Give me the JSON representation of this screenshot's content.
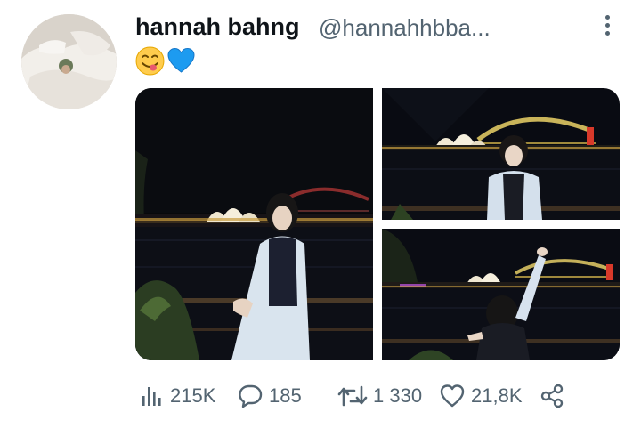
{
  "tweet": {
    "display_name": "hannah bahng",
    "handle": "@hannahhbba...",
    "emojis": [
      {
        "icon": "yum-face-emoji",
        "glyph": "😋"
      },
      {
        "icon": "blue-heart-emoji",
        "glyph": "💙"
      }
    ],
    "photos": [
      {
        "icon": "photo-opera-house-night-portrait"
      },
      {
        "icon": "photo-harbour-bridge-smiling"
      },
      {
        "icon": "photo-harbour-waving"
      }
    ]
  },
  "actions": {
    "views": {
      "icon": "bar-chart-icon",
      "value": "215K"
    },
    "replies": {
      "icon": "reply-bubble-icon",
      "value": "185"
    },
    "retweets": {
      "icon": "retweet-icon",
      "value": "1 330"
    },
    "likes": {
      "icon": "heart-icon",
      "value": "21,8K"
    },
    "share": {
      "icon": "share-icon"
    }
  },
  "colors": {
    "text": "#0f1419",
    "muted": "#536471",
    "background": "#ffffff"
  }
}
